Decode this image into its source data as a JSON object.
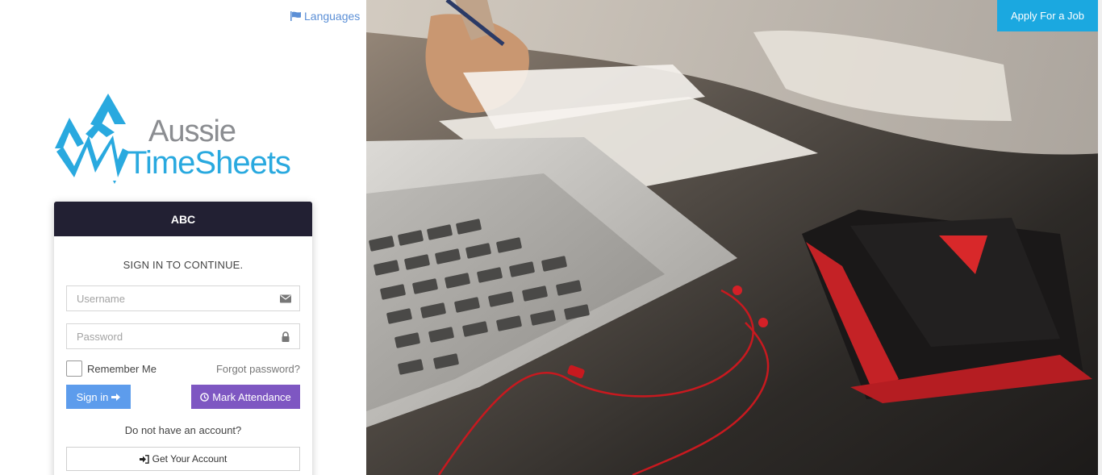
{
  "header": {
    "languages_label": "Languages",
    "apply_label": "Apply For a Job"
  },
  "logo": {
    "line1": "Aussie",
    "line2": "TimeSheets"
  },
  "login": {
    "company": "ABC",
    "subtitle": "SIGN IN TO CONTINUE.",
    "username_placeholder": "Username",
    "password_placeholder": "Password",
    "remember_label": "Remember Me",
    "forgot_label": "Forgot password?",
    "signin_label": "Sign in",
    "attendance_label": "Mark Attendance",
    "no_account_text": "Do not have an account?",
    "get_account_label": "Get Your Account"
  },
  "colors": {
    "accent_blue": "#1ba8e0",
    "signin_blue": "#5d9cec",
    "attendance_purple": "#7e57c2",
    "card_header": "#222033"
  },
  "icons": {
    "languages": "flag-icon",
    "username": "envelope-icon",
    "password": "lock-icon",
    "signin": "arrow-right-icon",
    "attendance": "clock-icon",
    "get_account": "sign-in-icon"
  }
}
